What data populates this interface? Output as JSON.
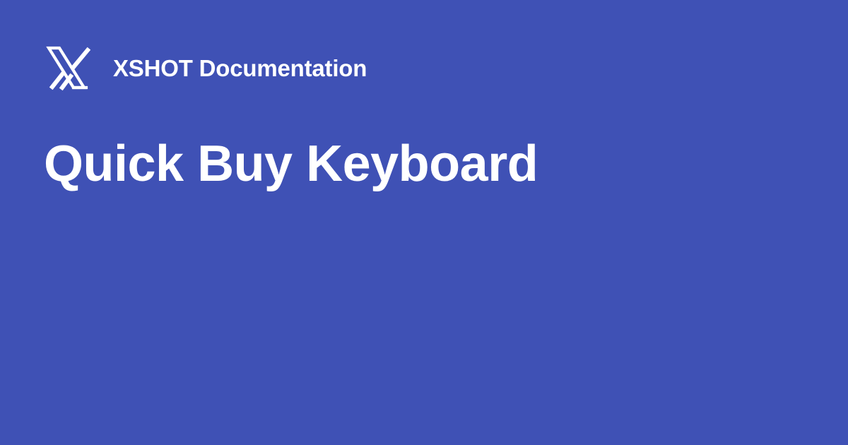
{
  "brand": {
    "logo_icon": "xshot-x-logo-icon",
    "site_name": "XSHOT Documentation"
  },
  "page": {
    "title": "Quick Buy Keyboard"
  },
  "colors": {
    "background": "#3f51b5",
    "text": "#ffffff"
  }
}
